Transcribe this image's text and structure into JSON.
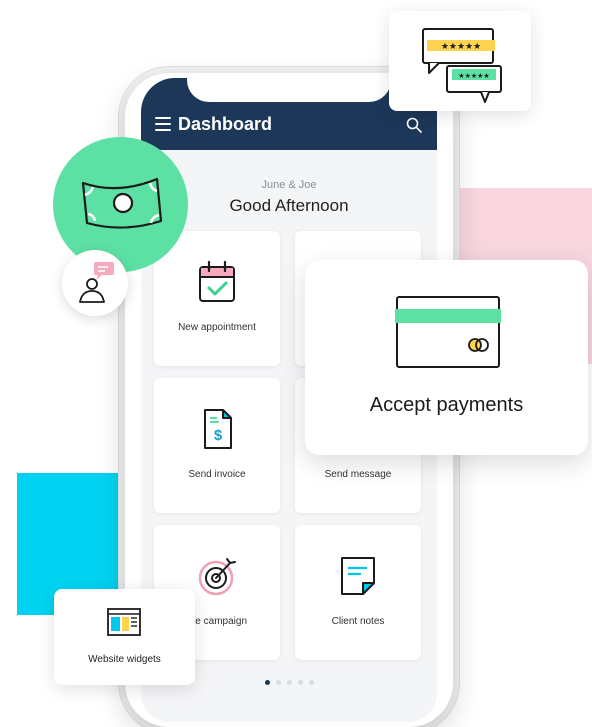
{
  "header": {
    "title": "Dashboard"
  },
  "greeting": {
    "names": "June & Joe",
    "message": "Good Afternoon"
  },
  "tiles": [
    {
      "label": "New appointment",
      "icon": "calendar-check-icon"
    },
    {
      "label": "Send invoice",
      "icon": "invoice-dollar-icon"
    },
    {
      "label": "Send message",
      "icon": "message-icon"
    },
    {
      "label": "ate campaign",
      "icon": "target-icon"
    },
    {
      "label": "Client notes",
      "icon": "sticky-note-icon"
    }
  ],
  "floating_cards": {
    "payments": {
      "label": "Accept payments",
      "icon": "credit-card-icon"
    },
    "widgets": {
      "label": "Website widgets",
      "icon": "web-layout-icon"
    },
    "reviews": {
      "icon": "star-reviews-icon"
    }
  },
  "pagination": {
    "total": 5,
    "active": 1
  },
  "colors": {
    "navy": "#1d3759",
    "green": "#5ce0a3",
    "pink": "#f9d6df",
    "cyan": "#00d3f1",
    "yellow": "#ffd34d"
  }
}
